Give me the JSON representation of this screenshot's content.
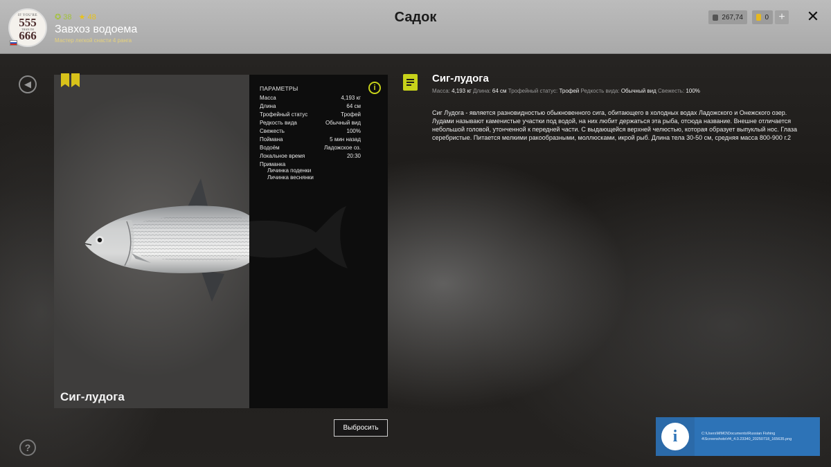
{
  "header": {
    "avatar_text": [
      "IF YOU'RE",
      "555",
      "THAN I'M",
      "666"
    ],
    "stat_a": "38",
    "stat_b": "48",
    "player_name": "Завхоз водоема",
    "player_rank": "Мастер легкой снасти 4 ранга",
    "title": "Садок",
    "money": "267,74",
    "gold": "0",
    "plus": "+",
    "close": "✕"
  },
  "fish": {
    "name": "Сиг-лудога",
    "card_label": "Сиг-лудога"
  },
  "params": {
    "title": "ПАРАМЕТРЫ",
    "rows": [
      {
        "label": "Масса",
        "value": "4,193 кг"
      },
      {
        "label": "Длина",
        "value": "64 см"
      },
      {
        "label": "Трофейный статус",
        "value": "Трофей"
      },
      {
        "label": "Редкость вида",
        "value": "Обычный вид"
      },
      {
        "label": "Свежесть",
        "value": "100%"
      },
      {
        "label": "Поймана",
        "value": "5 мин назад"
      },
      {
        "label": "Водоём",
        "value": "Ладожское оз."
      },
      {
        "label": "Локальное время",
        "value": "20:30"
      },
      {
        "label": "Приманка",
        "value": ""
      }
    ],
    "baits": [
      "Личинка поденки",
      "Личинка веснянки"
    ]
  },
  "description": {
    "title": "Сиг-лудога",
    "stats": [
      {
        "label": "Масса:",
        "value": "4,193 кг"
      },
      {
        "label": "Длина:",
        "value": "64 см"
      },
      {
        "label": "Трофейный статус:",
        "value": "Трофей"
      },
      {
        "label": "Редкость вида:",
        "value": "Обычный вид"
      },
      {
        "label": "Свежесть:",
        "value": "100%"
      }
    ],
    "text": "Сиг Лудога - является разновидностью обыкновенного сига, обитающего в холодных водах Ладожского и Онежского озер. Лудами называют каменистые участки под водой, на них любит держаться эта рыба, отсюда название. Внешне отличается небольшой головой, утонченной к передней части. С выдающейся верхней челюстью, которая образует выпуклый нос. Глаза серебристые. Питается мелкими ракообразными, моллюсками, икрой рыб. Длина тела 30-50 см, средняя масса 800-900 г.2"
  },
  "actions": {
    "drop": "Выбросить"
  },
  "notification": {
    "text": "C:\\Users\\MMO\\Documents\\Russian Fishing 4\\Screenshots\\rf4_4.0.23340_20250718_165635.png"
  },
  "icons": {
    "back": "back-arrow-icon",
    "help": "question-icon",
    "info": "info-icon",
    "note": "note-icon",
    "trophy": "trophy-bookmark-icon"
  },
  "colors": {
    "accent": "#c7d21a",
    "notification": "#2d73b7"
  }
}
